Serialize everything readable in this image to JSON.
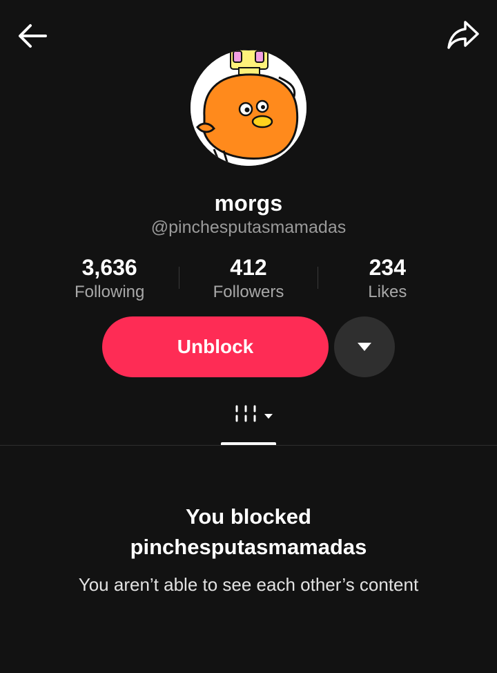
{
  "header": {
    "back_icon": "arrow-left-icon",
    "share_icon": "share-arrow-icon"
  },
  "profile": {
    "display_name": "morgs",
    "username": "@pinchesputasmamadas",
    "avatar": "orange-bird-crown-avatar"
  },
  "stats": [
    {
      "value": "3,636",
      "label": "Following"
    },
    {
      "value": "412",
      "label": "Followers"
    },
    {
      "value": "234",
      "label": "Likes"
    }
  ],
  "actions": {
    "unblock_label": "Unblock",
    "more_icon": "triangle-down-icon"
  },
  "tabs": {
    "grid_icon": "grid-icon",
    "dropdown_icon": "caret-down-icon"
  },
  "blocked_notice": {
    "title_line1": "You blocked",
    "title_line2": "pinchesputasmamadas",
    "message": "You aren’t able to see each other’s content"
  },
  "colors": {
    "background": "#121212",
    "accent": "#fe2c55",
    "secondary_button": "#2f2f2f",
    "muted_text": "#9a9a9a"
  }
}
